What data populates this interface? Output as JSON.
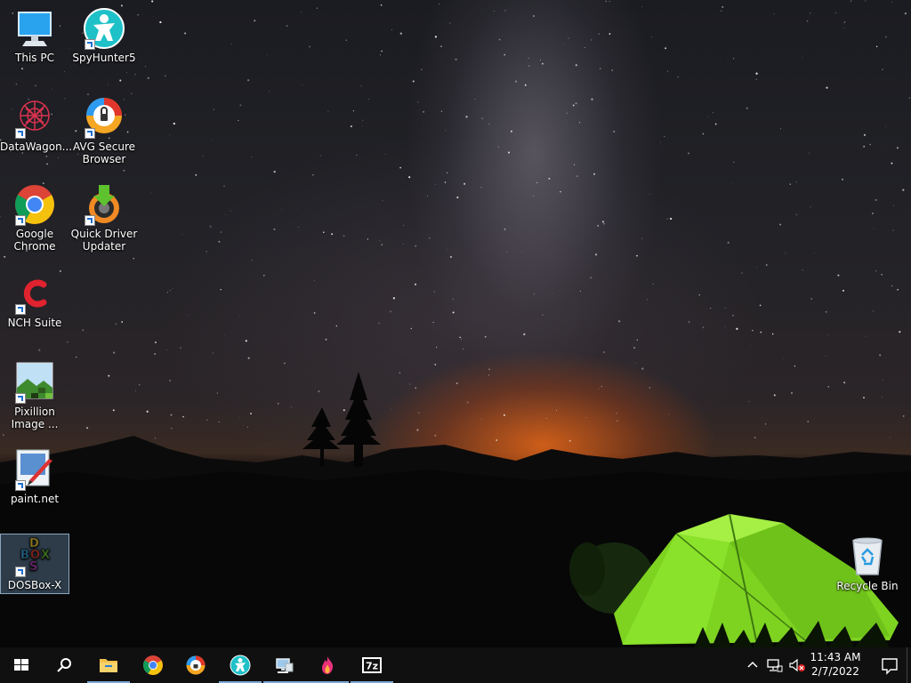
{
  "desktop": {
    "icons": [
      {
        "name": "this-pc",
        "label": "This PC"
      },
      {
        "name": "spyhunter5",
        "label": "SpyHunter5"
      },
      {
        "name": "datawagon",
        "label": "DataWagon..."
      },
      {
        "name": "avg-secure-browser",
        "label": "AVG Secure Browser"
      },
      {
        "name": "google-chrome",
        "label": "Google Chrome"
      },
      {
        "name": "quick-driver-updater",
        "label": "Quick Driver Updater"
      },
      {
        "name": "nch-suite",
        "label": "NCH Suite"
      },
      {
        "name": "pixillion-image",
        "label": "Pixillion Image ..."
      },
      {
        "name": "paint-net",
        "label": "paint.net"
      },
      {
        "name": "dosbox-x",
        "label": "DOSBox-X"
      },
      {
        "name": "recycle-bin",
        "label": "Recycle Bin"
      }
    ]
  },
  "taskbar": {
    "start_icon": "windows-logo-icon",
    "search_icon": "search-icon",
    "pinned": [
      {
        "name": "file-explorer",
        "icon": "folder-icon",
        "active": true
      },
      {
        "name": "google-chrome",
        "icon": "chrome-icon",
        "active": false
      },
      {
        "name": "avg-secure-browser",
        "icon": "avg-browser-icon",
        "active": false
      },
      {
        "name": "spyhunter5",
        "icon": "spyhunter-icon",
        "active": true
      },
      {
        "name": "network-computer",
        "icon": "computer-icon",
        "active": true
      },
      {
        "name": "flame-app",
        "icon": "flame-icon",
        "active": true
      },
      {
        "name": "7-zip",
        "icon": "7z-icon",
        "active": true,
        "text": "7z"
      }
    ],
    "tray": {
      "time": "11:43 AM",
      "date": "2/7/2022",
      "icons": [
        "chevron-up-icon",
        "network-icon",
        "volume-muted-icon",
        "notification-icon"
      ]
    }
  },
  "colors": {
    "taskbar_bg": "#101010",
    "accent": "#7aa7d6",
    "tent": "#7ed321",
    "sunset": "#ff6e14"
  }
}
